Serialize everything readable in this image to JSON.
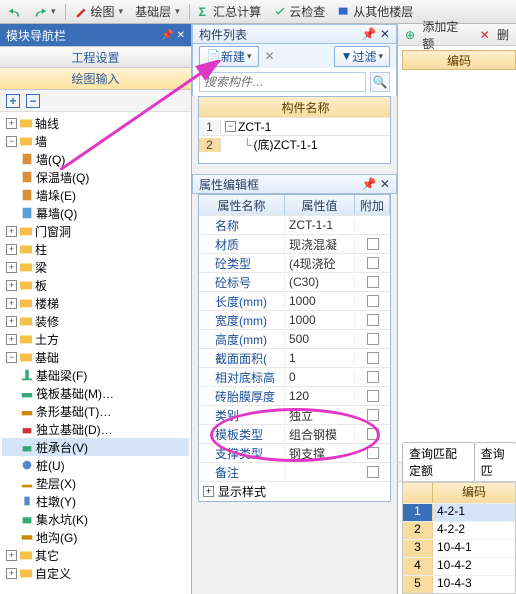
{
  "toolbar": {
    "drawing": "绘图",
    "base_layer": "基础层",
    "sum_calc": "汇总计算",
    "cloud_check": "云检查",
    "from_other": "从其他楼层"
  },
  "sidebar": {
    "title": "模块导航栏",
    "btn_project": "工程设置",
    "btn_drawinput": "绘图输入",
    "items": [
      "轴线",
      "墙",
      "墙(Q)",
      "保温墙(Q)",
      "墙垛(E)",
      "幕墙(Q)",
      "门窗洞",
      "柱",
      "梁",
      "板",
      "楼梯",
      "装修",
      "土方",
      "基础",
      "基础梁(F)",
      "筏板基础(M)…",
      "条形基础(T)…",
      "独立基础(D)…",
      "桩承台(V)",
      "桩(U)",
      "垫层(X)",
      "柱墩(Y)",
      "集水坑(K)",
      "地沟(G)",
      "其它",
      "自定义"
    ]
  },
  "component_list": {
    "title": "构件列表",
    "new": "新建",
    "filter": "过滤",
    "search_ph": "搜索构件…",
    "col": "构件名称",
    "rows": [
      {
        "n": "1",
        "name": "ZCT-1",
        "exp": "−"
      },
      {
        "n": "2",
        "name": "(底)ZCT-1-1",
        "exp": ""
      }
    ]
  },
  "props": {
    "title": "属性编辑框",
    "h0": "属性名称",
    "h1": "属性值",
    "h2": "附加",
    "rows": [
      {
        "k": "名称",
        "v": "ZCT-1-1",
        "c": false
      },
      {
        "k": "材质",
        "v": "现浇混凝",
        "c": true
      },
      {
        "k": "砼类型",
        "v": "(4现浇砼",
        "c": true
      },
      {
        "k": "砼标号",
        "v": "(C30)",
        "c": true
      },
      {
        "k": "长度(mm)",
        "v": "1000",
        "c": true
      },
      {
        "k": "宽度(mm)",
        "v": "1000",
        "c": true
      },
      {
        "k": "高度(mm)",
        "v": "500",
        "c": true
      },
      {
        "k": "截面面积(",
        "v": "1",
        "c": true
      },
      {
        "k": "相对底标高",
        "v": "0",
        "c": true
      },
      {
        "k": "砖胎膜厚度",
        "v": "120",
        "c": true
      },
      {
        "k": "类别",
        "v": "独立",
        "c": true
      },
      {
        "k": "模板类型",
        "v": "组合钢模",
        "c": true
      },
      {
        "k": "支撑类型",
        "v": "钢支撑",
        "c": true
      },
      {
        "k": "备注",
        "v": "",
        "c": true
      }
    ],
    "display_style": "显示样式"
  },
  "right": {
    "add_norm": "添加定额",
    "del": "删",
    "code_hdr": "编码",
    "tab_match": "查询匹配定额",
    "tab_query": "查询匹",
    "col": "编码",
    "rows": [
      {
        "n": "1",
        "v": "4-2-1"
      },
      {
        "n": "2",
        "v": "4-2-2"
      },
      {
        "n": "3",
        "v": "10-4-1"
      },
      {
        "n": "4",
        "v": "10-4-2"
      },
      {
        "n": "5",
        "v": "10-4-3"
      }
    ]
  }
}
